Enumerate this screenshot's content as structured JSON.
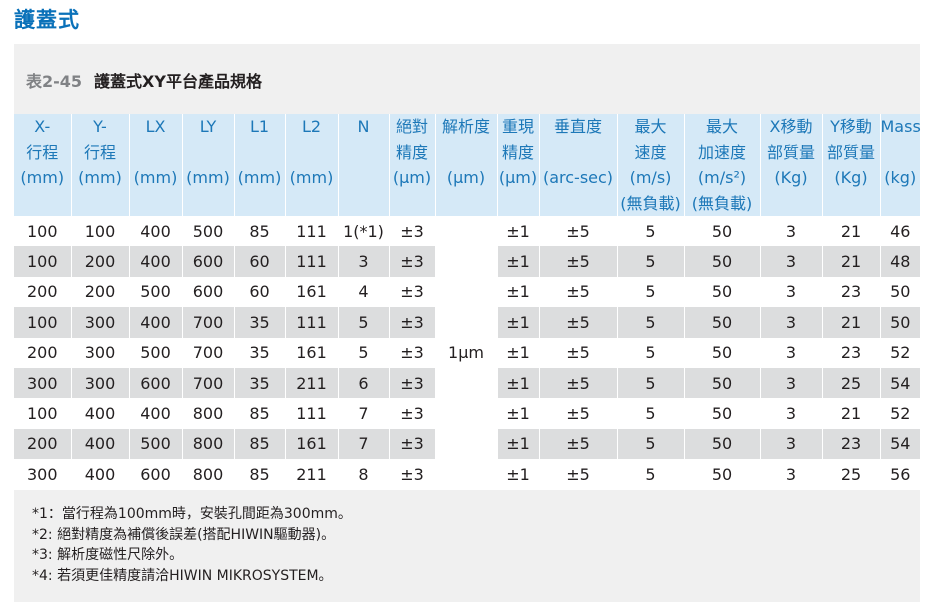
{
  "page": {
    "heading": "護蓋式"
  },
  "table": {
    "number": "表2-45",
    "title": "護蓋式XY平台產品規格",
    "columns": [
      "X-\n行程\n(mm)",
      "Y-\n行程\n(mm)",
      "LX\n\n(mm)",
      "LY\n\n(mm)",
      "L1\n\n(mm)",
      "L2\n\n(mm)",
      "N",
      "絕對\n精度\n(μm)",
      "解析度\n\n(μm)",
      "重現\n精度\n(μm)",
      "垂直度\n\n(arc-sec)",
      "最大\n速度\n(m/s)\n(無負載)",
      "最大\n加速度\n(m/s²)\n(無負載)",
      "X移動\n部質量\n(Kg)",
      "Y移動\n部質量\n(Kg)",
      "Mass\n\n(kg)"
    ],
    "resolution_value": "1μm",
    "rows": [
      [
        "100",
        "100",
        "400",
        "500",
        "85",
        "111",
        "1(*1)",
        "±3",
        "±1",
        "±5",
        "5",
        "50",
        "3",
        "21",
        "46"
      ],
      [
        "100",
        "200",
        "400",
        "600",
        "60",
        "111",
        "3",
        "±3",
        "±1",
        "±5",
        "5",
        "50",
        "3",
        "21",
        "48"
      ],
      [
        "200",
        "200",
        "500",
        "600",
        "60",
        "161",
        "4",
        "±3",
        "±1",
        "±5",
        "5",
        "50",
        "3",
        "23",
        "50"
      ],
      [
        "100",
        "300",
        "400",
        "700",
        "35",
        "111",
        "5",
        "±3",
        "±1",
        "±5",
        "5",
        "50",
        "3",
        "21",
        "50"
      ],
      [
        "200",
        "300",
        "500",
        "700",
        "35",
        "161",
        "5",
        "±3",
        "±1",
        "±5",
        "5",
        "50",
        "3",
        "23",
        "52"
      ],
      [
        "300",
        "300",
        "600",
        "700",
        "35",
        "211",
        "6",
        "±3",
        "±1",
        "±5",
        "5",
        "50",
        "3",
        "25",
        "54"
      ],
      [
        "100",
        "400",
        "400",
        "800",
        "85",
        "111",
        "7",
        "±3",
        "±1",
        "±5",
        "5",
        "50",
        "3",
        "21",
        "52"
      ],
      [
        "200",
        "400",
        "500",
        "800",
        "85",
        "161",
        "7",
        "±3",
        "±1",
        "±5",
        "5",
        "50",
        "3",
        "23",
        "54"
      ],
      [
        "300",
        "400",
        "600",
        "800",
        "85",
        "211",
        "8",
        "±3",
        "±1",
        "±5",
        "5",
        "50",
        "3",
        "25",
        "56"
      ]
    ]
  },
  "notes": [
    "*1：當行程為100mm時，安裝孔間距為300mm。",
    "*2: 絕對精度為補償後誤差(搭配HIWIN驅動器)。",
    "*3: 解析度磁性尺除外。",
    "*4: 若須更佳精度請洽HIWIN MIKROSYSTEM。"
  ],
  "colors": {
    "heading_blue": "#0a71b9",
    "header_bg": "#d5e9f7",
    "header_text": "#1d78b8",
    "stripe_gray": "#dcddde",
    "panel_bg": "#f0f0f0"
  }
}
